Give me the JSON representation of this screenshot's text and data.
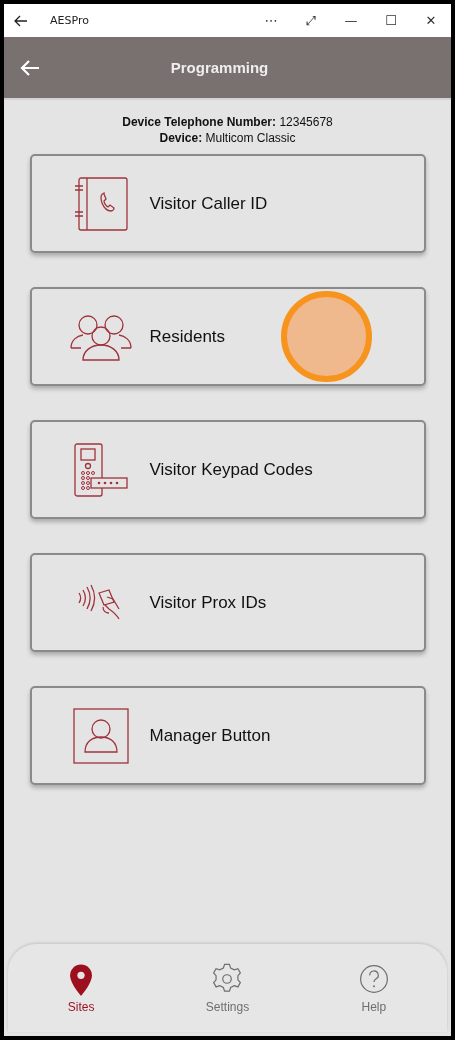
{
  "window": {
    "title": "AESPro",
    "controls": [
      "⋯",
      "⤢",
      "—",
      "☐",
      "✕"
    ]
  },
  "header": {
    "title": "Programming"
  },
  "device_info": {
    "phone_label": "Device Telephone Number:",
    "phone": "12345678",
    "device_label": "Device:",
    "device": "Multicom Classic"
  },
  "menu": [
    {
      "kind": "phonebook",
      "label": "Visitor Caller ID",
      "touched": false
    },
    {
      "kind": "people",
      "label": "Residents",
      "touched": true
    },
    {
      "kind": "keypad",
      "label": "Visitor Keypad Codes",
      "touched": false
    },
    {
      "kind": "prox",
      "label": "Visitor Prox IDs",
      "touched": false
    },
    {
      "kind": "manager",
      "label": "Manager Button",
      "touched": false
    }
  ],
  "bottom_nav": [
    {
      "kind": "pin",
      "label": "Sites",
      "selected": true
    },
    {
      "kind": "gear",
      "label": "Settings",
      "selected": false
    },
    {
      "kind": "help",
      "label": "Help",
      "selected": false
    }
  ]
}
